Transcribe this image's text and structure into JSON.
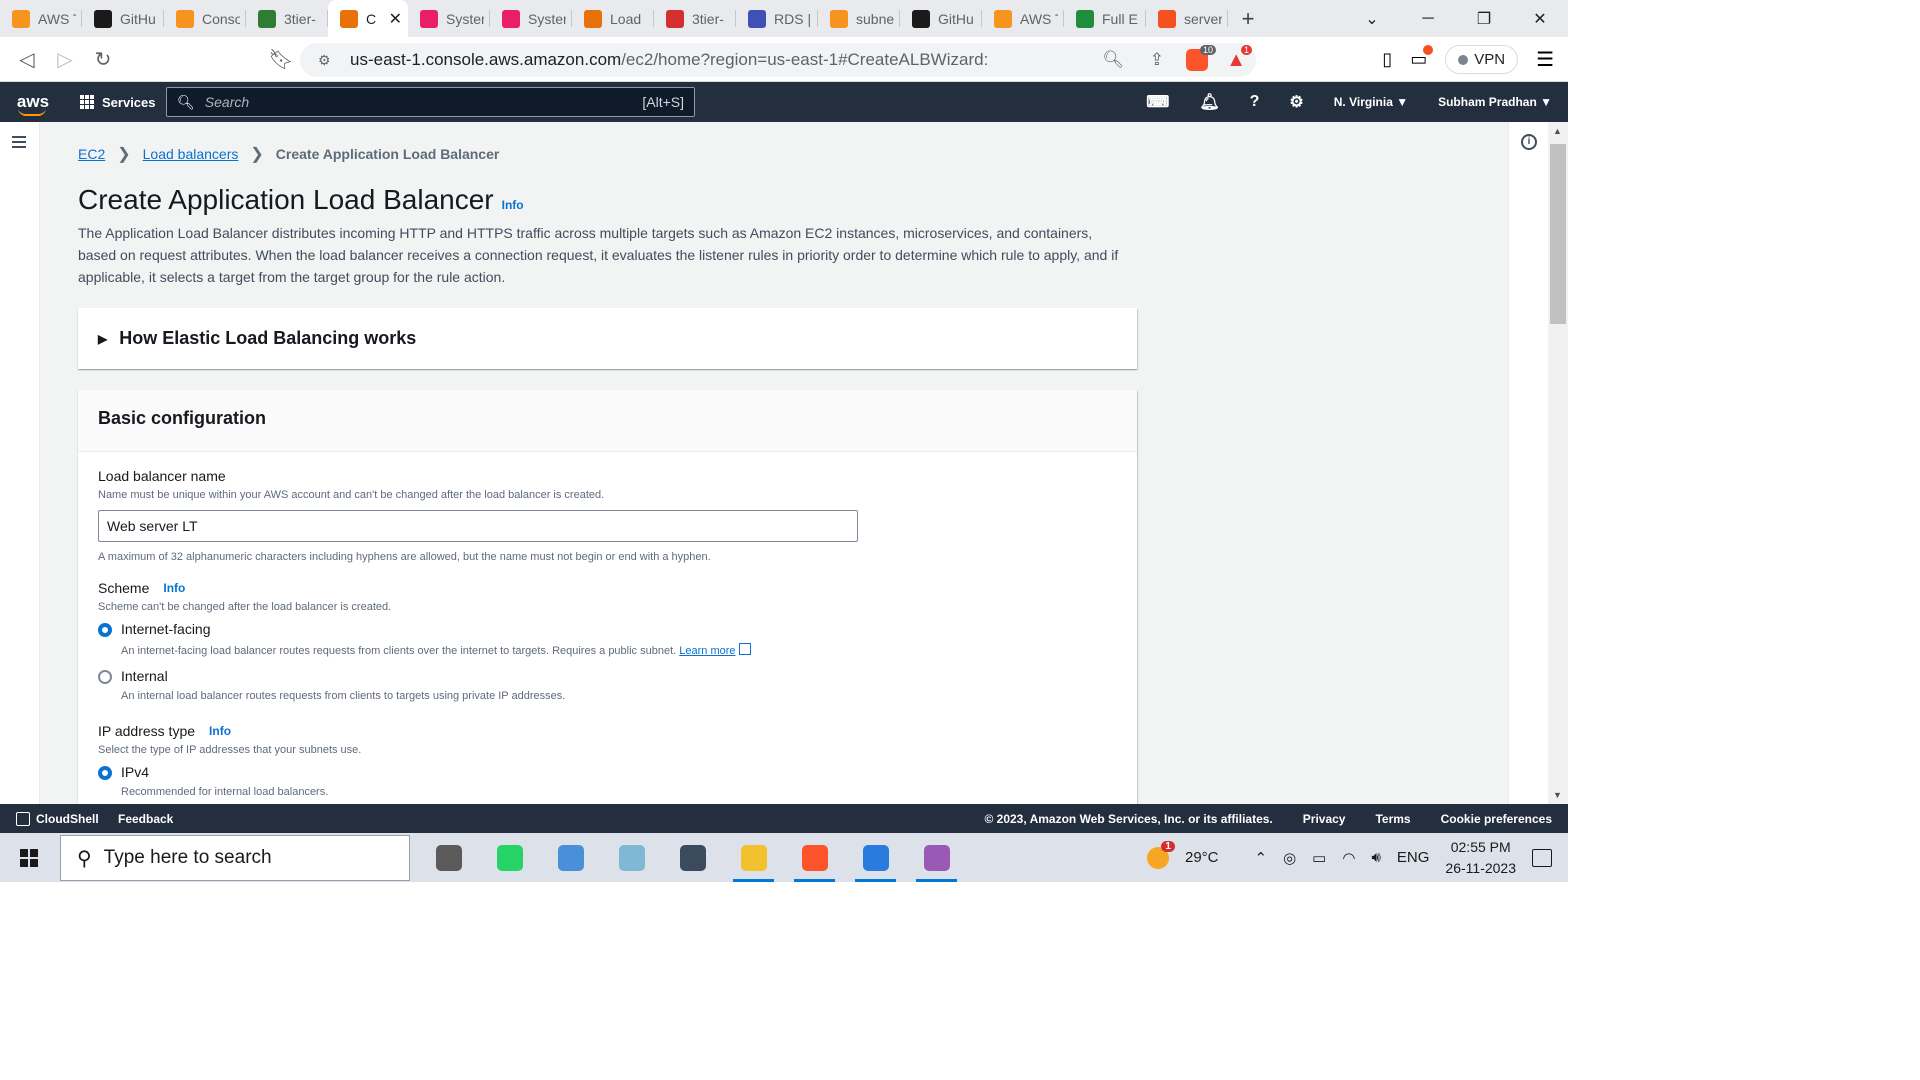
{
  "browser": {
    "tabs": [
      {
        "label": "AWS T",
        "color": "#f7941d"
      },
      {
        "label": "GitHu",
        "color": "#1a1a1a"
      },
      {
        "label": "Conso",
        "color": "#f7941d"
      },
      {
        "label": "3tier-",
        "color": "#2e7d32"
      },
      {
        "label": "C",
        "color": "#e8710a",
        "active": true
      },
      {
        "label": "Syster",
        "color": "#e91e63"
      },
      {
        "label": "Syster",
        "color": "#e91e63"
      },
      {
        "label": "Load",
        "color": "#e8710a"
      },
      {
        "label": "3tier-",
        "color": "#d32f2f"
      },
      {
        "label": "RDS |",
        "color": "#3f51b5"
      },
      {
        "label": "subne",
        "color": "#f7941d"
      },
      {
        "label": "GitHu",
        "color": "#1a1a1a"
      },
      {
        "label": "AWS T",
        "color": "#f7941d"
      },
      {
        "label": "Full E",
        "color": "#1e8e3e"
      },
      {
        "label": "server",
        "color": "#f4511e"
      }
    ],
    "url_host": "us-east-1.console.aws.amazon.com",
    "url_path": "/ec2/home?region=us-east-1#CreateALBWizard:",
    "brave_badge": "10",
    "rewards_badge": "1",
    "vpn_label": "VPN"
  },
  "aws_nav": {
    "logo": "aws",
    "services_label": "Services",
    "search_placeholder": "Search",
    "search_shortcut": "[Alt+S]",
    "region": "N. Virginia ▼",
    "user": "Subham Pradhan ▼"
  },
  "breadcrumb": {
    "items": [
      "EC2",
      "Load balancers",
      "Create Application Load Balancer"
    ]
  },
  "page": {
    "title": "Create Application Load Balancer",
    "info": "Info",
    "description": "The Application Load Balancer distributes incoming HTTP and HTTPS traffic across multiple targets such as Amazon EC2 instances, microservices, and containers, based on request attributes. When the load balancer receives a connection request, it evaluates the listener rules in priority order to determine which rule to apply, and if applicable, it selects a target from the target group for the rule action."
  },
  "how_section": {
    "title": "How Elastic Load Balancing works"
  },
  "basic_config": {
    "title": "Basic configuration",
    "name_label": "Load balancer name",
    "name_desc": "Name must be unique within your AWS account and can't be changed after the load balancer is created.",
    "name_value": "Web server LT",
    "name_hint": "A maximum of 32 alphanumeric characters including hyphens are allowed, but the name must not begin or end with a hyphen.",
    "scheme_label": "Scheme",
    "scheme_info": "Info",
    "scheme_desc": "Scheme can't be changed after the load balancer is created.",
    "scheme_options": [
      {
        "label": "Internet-facing",
        "desc": "An internet-facing load balancer routes requests from clients over the internet to targets. Requires a public subnet.",
        "link": "Learn more",
        "selected": true
      },
      {
        "label": "Internal",
        "desc": "An internal load balancer routes requests from clients to targets using private IP addresses.",
        "selected": false
      }
    ],
    "ip_label": "IP address type",
    "ip_info": "Info",
    "ip_desc": "Select the type of IP addresses that your subnets use.",
    "ip_options": [
      {
        "label": "IPv4",
        "desc": "Recommended for internal load balancers.",
        "selected": true
      }
    ]
  },
  "aws_footer": {
    "cloudshell": "CloudShell",
    "feedback": "Feedback",
    "copyright": "© 2023, Amazon Web Services, Inc. or its affiliates.",
    "privacy": "Privacy",
    "terms": "Terms",
    "cookies": "Cookie preferences"
  },
  "taskbar": {
    "search_placeholder": "Type here to search",
    "apps": [
      {
        "name": "task-view",
        "color": "#5a5a5a",
        "running": false
      },
      {
        "name": "whatsapp",
        "color": "#25d366",
        "running": false
      },
      {
        "name": "laptop-app",
        "color": "#4a90d9",
        "running": false
      },
      {
        "name": "notebook-app",
        "color": "#7fb8d4",
        "running": false
      },
      {
        "name": "camera",
        "color": "#3b4a5c",
        "running": false
      },
      {
        "name": "file-explorer",
        "color": "#f2c12e",
        "running": true
      },
      {
        "name": "brave",
        "color": "#fb542b",
        "running": true
      },
      {
        "name": "photos",
        "color": "#2a7bde",
        "running": true
      },
      {
        "name": "git-app",
        "color": "#9b59b6",
        "running": true
      }
    ],
    "weather_badge": "1",
    "temperature": "29°C",
    "language": "ENG",
    "time": "02:55 PM",
    "date": "26-11-2023"
  }
}
